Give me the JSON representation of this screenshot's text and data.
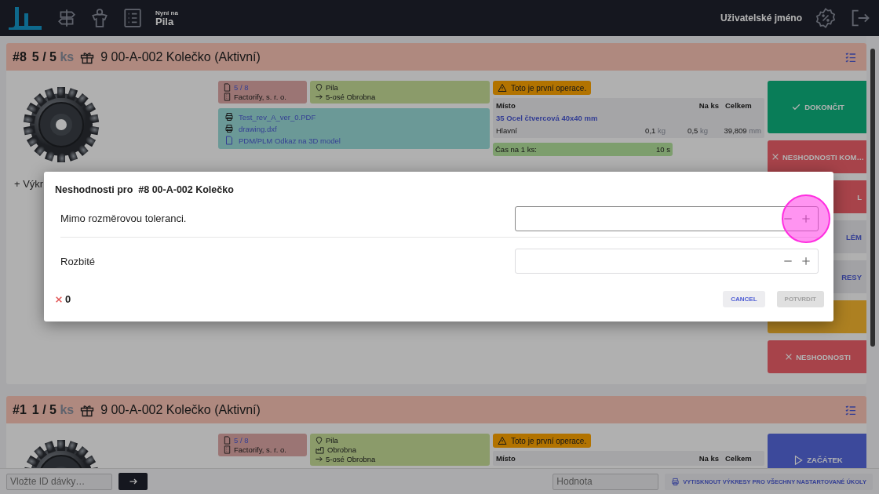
{
  "topbar": {
    "now_label": "Nyní na",
    "now_value": "Pila",
    "username": "Uživatelské jméno"
  },
  "tasks": [
    {
      "id": "#8",
      "quantity": "5 / 5",
      "unit": "ks",
      "title": "9 00-A-002 Kolečko (Aktivní)",
      "batch": "5 / 8",
      "company": "Factorify, s. r. o.",
      "locations": [
        {
          "kind": "pin",
          "text": "Pila"
        },
        {
          "kind": "arrow",
          "text": "5-osé Obrobna"
        }
      ],
      "files": [
        {
          "kind": "print",
          "text": "Test_rev_A_ver_0.PDF"
        },
        {
          "kind": "print",
          "text": "drawing.dxf"
        },
        {
          "kind": "pdf",
          "text": "PDM/PLM Odkaz na 3D model"
        }
      ],
      "warning": "Toto je první operace.",
      "material": {
        "headers": [
          "Místo",
          "Na ks",
          "Celkem"
        ],
        "item": "35 Ocel čtvercová 40x40 mm",
        "rows": [
          {
            "name": "Hlavní",
            "per_piece": "0,1",
            "per_piece_unit": "kg",
            "total": "0,5",
            "total_unit": "kg",
            "length": "39,809",
            "length_unit": "mm"
          }
        ]
      },
      "time_label": "Čas na 1 ks:",
      "time_value": "10 s",
      "link": "+ Výkr",
      "actions": [
        {
          "kind": "finish",
          "label": "DOKONČIT"
        },
        {
          "kind": "defects",
          "label": "NESHODNOSTI KOM…"
        },
        {
          "kind": "danger",
          "label": "L"
        },
        {
          "kind": "neutral",
          "label": "LÉM"
        },
        {
          "kind": "neutral",
          "label": "RESY"
        },
        {
          "kind": "warning"
        },
        {
          "kind": "defects",
          "label": "NESHODNOSTI"
        }
      ]
    },
    {
      "id": "#1",
      "quantity": "1 / 5",
      "unit": "ks",
      "title": "9 00-A-002 Kolečko (Aktivní)",
      "batch": "5 / 8",
      "company": "Factorify, s. r. o.",
      "locations": [
        {
          "kind": "pin",
          "text": "Pila"
        },
        {
          "kind": "building",
          "text": "Obrobna"
        },
        {
          "kind": "arrow",
          "text": "5-osé Obrobna"
        }
      ],
      "warning": "Toto je první operace.",
      "material": {
        "headers": [
          "Místo",
          "Na ks",
          "Celkem"
        ]
      },
      "actions": [
        {
          "kind": "start",
          "label": "ZAČÁTEK"
        }
      ]
    }
  ],
  "dialog": {
    "title": "Neshodnosti pro  #8 00-A-002 Kolečko",
    "rows": [
      {
        "label": "Mimo rozměrovou toleranci.",
        "focused": true,
        "tapped": true
      },
      {
        "label": "Rozbité",
        "focused": false
      }
    ],
    "total": "0",
    "buttons": [
      {
        "kind": "cancel",
        "label": "CANCEL"
      },
      {
        "kind": "confirm",
        "label": "POTVRDIT",
        "disabled": true
      }
    ]
  },
  "bottom": {
    "batch_placeholder": "Vložte ID dávky…",
    "value_placeholder": "Hodnota",
    "print_button": "VYTISKNOUT VÝKRESY PRO VŠECHNY NASTARTOVANÉ ÚKOLY"
  }
}
